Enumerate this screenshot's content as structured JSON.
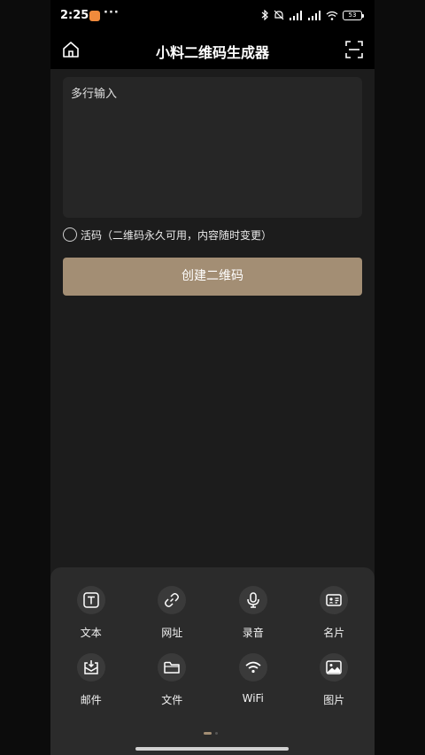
{
  "status": {
    "time": "2:25",
    "more": "···",
    "battery": "53"
  },
  "header": {
    "title": "小料二维码生成器"
  },
  "input": {
    "placeholder": "多行输入"
  },
  "live_code": {
    "label": "活码（二维码永久可用，内容随时变更）",
    "checked": false
  },
  "create_button": {
    "label": "创建二维码"
  },
  "tools": [
    {
      "label": "文本",
      "icon": "text-icon"
    },
    {
      "label": "网址",
      "icon": "link-icon"
    },
    {
      "label": "录音",
      "icon": "microphone-icon"
    },
    {
      "label": "名片",
      "icon": "business-card-icon"
    },
    {
      "label": "邮件",
      "icon": "mail-icon"
    },
    {
      "label": "文件",
      "icon": "folder-icon"
    },
    {
      "label": "WiFi",
      "icon": "wifi-icon"
    },
    {
      "label": "图片",
      "icon": "image-icon"
    }
  ],
  "colors": {
    "accent": "#a38e74",
    "background": "#1c1c1c",
    "panel": "#2b2b2b"
  }
}
